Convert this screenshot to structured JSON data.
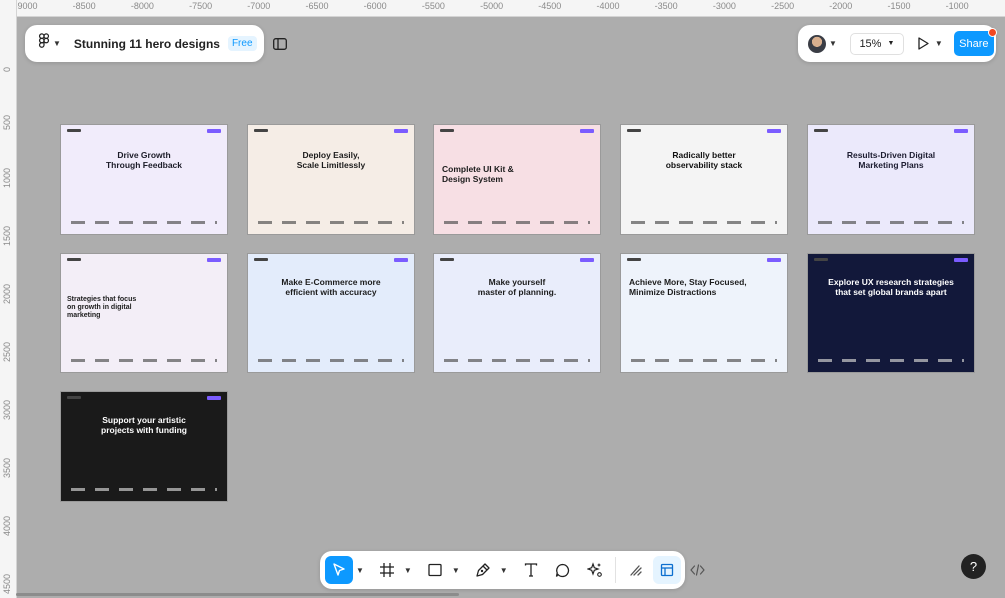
{
  "ruler": {
    "top_ticks": [
      "-9000",
      "-8500",
      "-8000",
      "-7500",
      "-7000",
      "-6500",
      "-6000",
      "-5500",
      "-5000",
      "-4500",
      "-4000",
      "-3500",
      "-3000",
      "-2500",
      "-2000",
      "-1500",
      "-1000"
    ],
    "left_ticks": [
      "0",
      "500",
      "1000",
      "1500",
      "2000",
      "2500",
      "3000",
      "3500",
      "4000",
      "4500"
    ]
  },
  "file": {
    "title": "Stunning 11 hero designs",
    "plan_badge": "Free"
  },
  "header_right": {
    "zoom": "15%",
    "share_label": "Share"
  },
  "frames": [
    {
      "heading": "Drive Growth\nThrough Feedback",
      "accent": "Growth",
      "bg": "#f1ecfb",
      "text": "#1c1c28"
    },
    {
      "heading": "Deploy Easily,\nScale Limitlessly",
      "bg": "#f5ede6",
      "text": "#1c1c1c"
    },
    {
      "heading": "Complete UI Kit &\nDesign System",
      "bg": "#f7dfe4",
      "text": "#1c1c1c"
    },
    {
      "heading": "Radically better\nobservability stack",
      "bg": "#f4f4f4",
      "text": "#111111"
    },
    {
      "heading": "Results-Driven Digital\nMarketing Plans",
      "bg": "#ebe9fb",
      "text": "#1c1c30"
    },
    {
      "heading": "Strategies that focus\non growth in digital\nmarketing",
      "bg": "#f3eef7",
      "text": "#1c1c1c"
    },
    {
      "heading": "Make E-Commerce more\nefficient with accuracy",
      "accent": "efficient",
      "bg": "#e3ecfb",
      "text": "#1c1c1c"
    },
    {
      "heading": "Make yourself\nmaster of planning.",
      "accent": "master of planning.",
      "bg": "#e9edfb",
      "text": "#1c1c1c"
    },
    {
      "heading": "Achieve More, Stay Focused,\nMinimize Distractions",
      "bg": "#eef3fb",
      "text": "#1c1c1c"
    },
    {
      "heading": "Explore UX research strategies\nthat set global brands apart",
      "bg": "#12183a",
      "text": "#ffffff"
    },
    {
      "heading": "Support your artistic\nprojects with funding",
      "accent": "funding",
      "bg": "#1a1a1a",
      "text": "#ffffff"
    }
  ],
  "toolbar": {
    "tools": [
      "move-tool",
      "frame-tool",
      "shape-tool",
      "pen-tool",
      "text-tool",
      "comment-tool",
      "actions-tool"
    ],
    "modes": [
      "draw-mode",
      "design-mode",
      "dev-mode"
    ]
  },
  "help": {
    "label": "?"
  },
  "colors": {
    "canvas": "#adadad",
    "accent": "#0d99ff"
  }
}
